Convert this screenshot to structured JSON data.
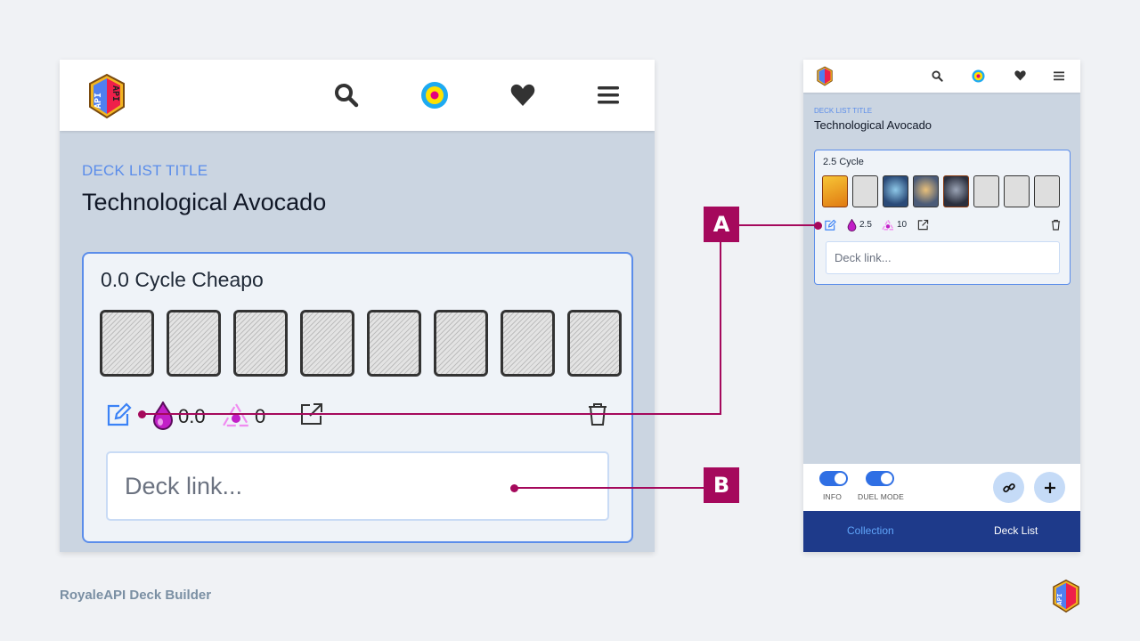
{
  "app": {
    "footer_title": "RoyaleAPI Deck Builder",
    "logo_text": "API"
  },
  "nav": {
    "icons": [
      "search-icon",
      "target-icon",
      "heart-icon",
      "menu-icon"
    ]
  },
  "large_view": {
    "title_label": "DECK LIST TITLE",
    "title": "Technological Avocado",
    "deck": {
      "name": "0.0 Cycle Cheapo",
      "slots": [
        "empty",
        "empty",
        "empty",
        "empty",
        "empty",
        "empty",
        "empty",
        "empty"
      ],
      "avg_elixir": "0.0",
      "cycle": "0",
      "link_placeholder": "Deck link..."
    }
  },
  "small_view": {
    "title_label": "DECK LIST TITLE",
    "title": "Technological Avocado",
    "deck": {
      "name": "2.5 Cycle",
      "slots": [
        "Heal Spirit",
        "empty",
        "Minions",
        "Royal Giant",
        "Dark Knight",
        "empty",
        "empty",
        "empty"
      ],
      "avg_elixir": "2.5",
      "cycle": "10",
      "link_placeholder": "Deck link..."
    },
    "toggles": [
      {
        "label": "INFO",
        "on": true
      },
      {
        "label": "DUEL MODE",
        "on": true
      }
    ],
    "tabs": [
      {
        "label": "Collection",
        "active": false
      },
      {
        "label": "Deck List",
        "active": true
      }
    ]
  },
  "callouts": {
    "a": "A",
    "b": "B"
  },
  "colors": {
    "accent": "#5b8dea",
    "callout": "#a5095c",
    "tabbar": "#1e3a8a",
    "elixir": "#c21fc7"
  }
}
